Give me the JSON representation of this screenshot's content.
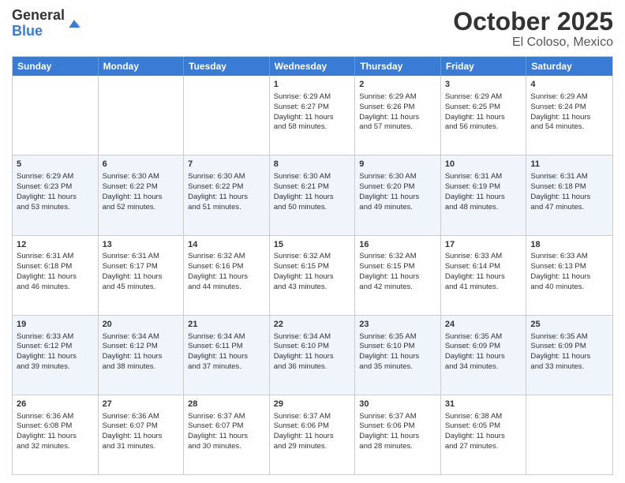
{
  "header": {
    "logo_line1": "General",
    "logo_line2": "Blue",
    "title": "October 2025",
    "subtitle": "El Coloso, Mexico"
  },
  "calendar": {
    "weekdays": [
      "Sunday",
      "Monday",
      "Tuesday",
      "Wednesday",
      "Thursday",
      "Friday",
      "Saturday"
    ],
    "rows": [
      {
        "alt": false,
        "cells": [
          {
            "day": "",
            "content": ""
          },
          {
            "day": "",
            "content": ""
          },
          {
            "day": "",
            "content": ""
          },
          {
            "day": "1",
            "content": "Sunrise: 6:29 AM\nSunset: 6:27 PM\nDaylight: 11 hours\nand 58 minutes."
          },
          {
            "day": "2",
            "content": "Sunrise: 6:29 AM\nSunset: 6:26 PM\nDaylight: 11 hours\nand 57 minutes."
          },
          {
            "day": "3",
            "content": "Sunrise: 6:29 AM\nSunset: 6:25 PM\nDaylight: 11 hours\nand 56 minutes."
          },
          {
            "day": "4",
            "content": "Sunrise: 6:29 AM\nSunset: 6:24 PM\nDaylight: 11 hours\nand 54 minutes."
          }
        ]
      },
      {
        "alt": true,
        "cells": [
          {
            "day": "5",
            "content": "Sunrise: 6:29 AM\nSunset: 6:23 PM\nDaylight: 11 hours\nand 53 minutes."
          },
          {
            "day": "6",
            "content": "Sunrise: 6:30 AM\nSunset: 6:22 PM\nDaylight: 11 hours\nand 52 minutes."
          },
          {
            "day": "7",
            "content": "Sunrise: 6:30 AM\nSunset: 6:22 PM\nDaylight: 11 hours\nand 51 minutes."
          },
          {
            "day": "8",
            "content": "Sunrise: 6:30 AM\nSunset: 6:21 PM\nDaylight: 11 hours\nand 50 minutes."
          },
          {
            "day": "9",
            "content": "Sunrise: 6:30 AM\nSunset: 6:20 PM\nDaylight: 11 hours\nand 49 minutes."
          },
          {
            "day": "10",
            "content": "Sunrise: 6:31 AM\nSunset: 6:19 PM\nDaylight: 11 hours\nand 48 minutes."
          },
          {
            "day": "11",
            "content": "Sunrise: 6:31 AM\nSunset: 6:18 PM\nDaylight: 11 hours\nand 47 minutes."
          }
        ]
      },
      {
        "alt": false,
        "cells": [
          {
            "day": "12",
            "content": "Sunrise: 6:31 AM\nSunset: 6:18 PM\nDaylight: 11 hours\nand 46 minutes."
          },
          {
            "day": "13",
            "content": "Sunrise: 6:31 AM\nSunset: 6:17 PM\nDaylight: 11 hours\nand 45 minutes."
          },
          {
            "day": "14",
            "content": "Sunrise: 6:32 AM\nSunset: 6:16 PM\nDaylight: 11 hours\nand 44 minutes."
          },
          {
            "day": "15",
            "content": "Sunrise: 6:32 AM\nSunset: 6:15 PM\nDaylight: 11 hours\nand 43 minutes."
          },
          {
            "day": "16",
            "content": "Sunrise: 6:32 AM\nSunset: 6:15 PM\nDaylight: 11 hours\nand 42 minutes."
          },
          {
            "day": "17",
            "content": "Sunrise: 6:33 AM\nSunset: 6:14 PM\nDaylight: 11 hours\nand 41 minutes."
          },
          {
            "day": "18",
            "content": "Sunrise: 6:33 AM\nSunset: 6:13 PM\nDaylight: 11 hours\nand 40 minutes."
          }
        ]
      },
      {
        "alt": true,
        "cells": [
          {
            "day": "19",
            "content": "Sunrise: 6:33 AM\nSunset: 6:12 PM\nDaylight: 11 hours\nand 39 minutes."
          },
          {
            "day": "20",
            "content": "Sunrise: 6:34 AM\nSunset: 6:12 PM\nDaylight: 11 hours\nand 38 minutes."
          },
          {
            "day": "21",
            "content": "Sunrise: 6:34 AM\nSunset: 6:11 PM\nDaylight: 11 hours\nand 37 minutes."
          },
          {
            "day": "22",
            "content": "Sunrise: 6:34 AM\nSunset: 6:10 PM\nDaylight: 11 hours\nand 36 minutes."
          },
          {
            "day": "23",
            "content": "Sunrise: 6:35 AM\nSunset: 6:10 PM\nDaylight: 11 hours\nand 35 minutes."
          },
          {
            "day": "24",
            "content": "Sunrise: 6:35 AM\nSunset: 6:09 PM\nDaylight: 11 hours\nand 34 minutes."
          },
          {
            "day": "25",
            "content": "Sunrise: 6:35 AM\nSunset: 6:09 PM\nDaylight: 11 hours\nand 33 minutes."
          }
        ]
      },
      {
        "alt": false,
        "cells": [
          {
            "day": "26",
            "content": "Sunrise: 6:36 AM\nSunset: 6:08 PM\nDaylight: 11 hours\nand 32 minutes."
          },
          {
            "day": "27",
            "content": "Sunrise: 6:36 AM\nSunset: 6:07 PM\nDaylight: 11 hours\nand 31 minutes."
          },
          {
            "day": "28",
            "content": "Sunrise: 6:37 AM\nSunset: 6:07 PM\nDaylight: 11 hours\nand 30 minutes."
          },
          {
            "day": "29",
            "content": "Sunrise: 6:37 AM\nSunset: 6:06 PM\nDaylight: 11 hours\nand 29 minutes."
          },
          {
            "day": "30",
            "content": "Sunrise: 6:37 AM\nSunset: 6:06 PM\nDaylight: 11 hours\nand 28 minutes."
          },
          {
            "day": "31",
            "content": "Sunrise: 6:38 AM\nSunset: 6:05 PM\nDaylight: 11 hours\nand 27 minutes."
          },
          {
            "day": "",
            "content": ""
          }
        ]
      }
    ]
  }
}
